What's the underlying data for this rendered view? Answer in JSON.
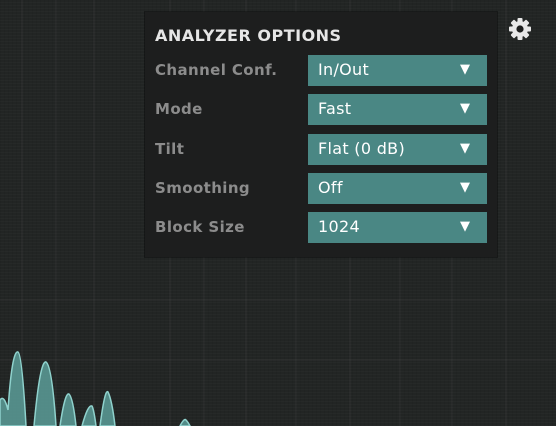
{
  "panel": {
    "title": "ANALYZER OPTIONS",
    "options": [
      {
        "label": "Channel Conf.",
        "value": "In/Out"
      },
      {
        "label": "Mode",
        "value": "Fast"
      },
      {
        "label": "Tilt",
        "value": "Flat (0 dB)"
      },
      {
        "label": "Smoothing",
        "value": "Off"
      },
      {
        "label": "Block Size",
        "value": "1024"
      }
    ],
    "caret_icon": "caret-down-icon"
  },
  "toolbar": {
    "settings_icon": "gear-icon"
  },
  "colors": {
    "background": "#222524",
    "panel": "#1d1e1e",
    "select_accent": "#4a8784",
    "spectrum": "#7fc4c0",
    "label": "#8c8c8c",
    "title": "#e6e6e6"
  }
}
